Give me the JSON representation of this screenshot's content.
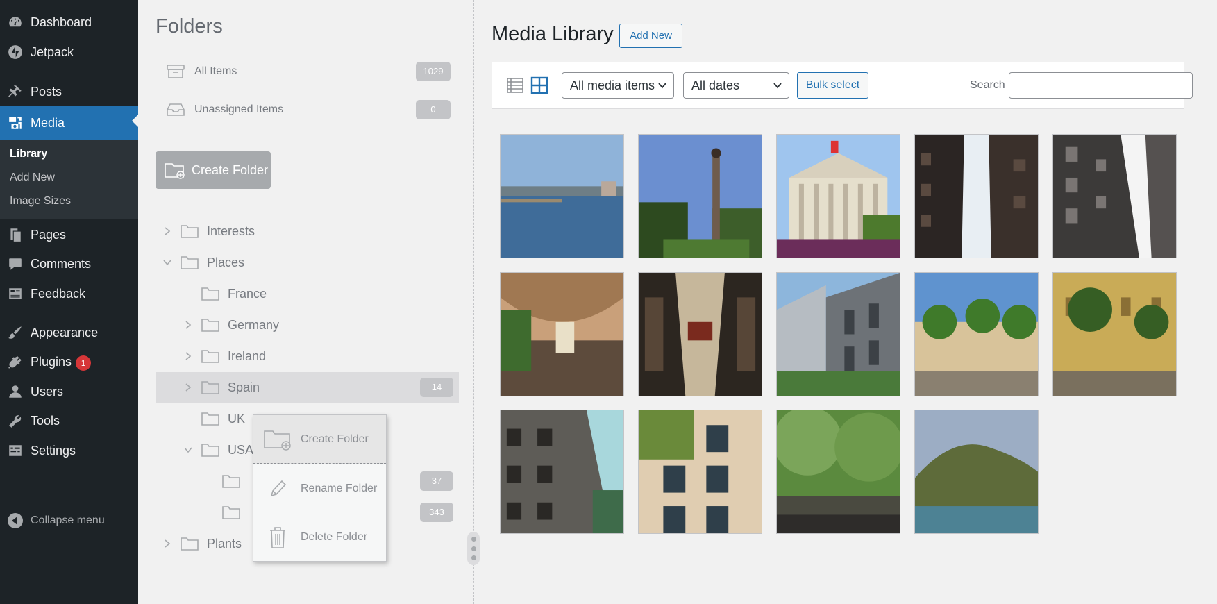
{
  "admin_menu": {
    "items": [
      {
        "label": "Dashboard",
        "icon": "dashboard-icon"
      },
      {
        "label": "Jetpack",
        "icon": "jetpack-icon"
      },
      {
        "label": "Posts",
        "icon": "pushpin-icon"
      },
      {
        "label": "Media",
        "icon": "media-icon"
      },
      {
        "label": "Pages",
        "icon": "pages-icon"
      },
      {
        "label": "Comments",
        "icon": "comment-icon"
      },
      {
        "label": "Feedback",
        "icon": "feedback-icon"
      },
      {
        "label": "Appearance",
        "icon": "paintbrush-icon"
      },
      {
        "label": "Plugins",
        "icon": "plugin-icon",
        "badge": "1"
      },
      {
        "label": "Users",
        "icon": "user-icon"
      },
      {
        "label": "Tools",
        "icon": "wrench-icon"
      },
      {
        "label": "Settings",
        "icon": "settings-icon"
      }
    ],
    "media_submenu": [
      "Library",
      "Add New",
      "Image Sizes"
    ],
    "collapse_label": "Collapse menu"
  },
  "folders": {
    "title": "Folders",
    "all_items": {
      "label": "All Items",
      "count": "1029"
    },
    "unassigned": {
      "label": "Unassigned Items",
      "count": "0"
    },
    "create_button": "Create Folder",
    "tree": [
      {
        "label": "Interests",
        "count": ""
      },
      {
        "label": "Places",
        "count": ""
      },
      {
        "label": "France",
        "count": ""
      },
      {
        "label": "Germany",
        "count": ""
      },
      {
        "label": "Ireland",
        "count": ""
      },
      {
        "label": "Spain",
        "count": "14"
      },
      {
        "label": "UK",
        "count": ""
      },
      {
        "label": "USA",
        "count": ""
      },
      {
        "label": "",
        "count": "37"
      },
      {
        "label": "",
        "count": "343"
      },
      {
        "label": "Plants",
        "count": ""
      }
    ],
    "context_menu": [
      "Create Folder",
      "Rename Folder",
      "Delete Folder"
    ]
  },
  "media": {
    "title": "Media Library",
    "add_new": "Add New",
    "filter_type": "All media items",
    "filter_date": "All dates",
    "bulk_select": "Bulk select",
    "search_label": "Search",
    "search_value": ""
  },
  "colors": {
    "sidebar_bg": "#1d2327",
    "accent": "#2271b1",
    "badge": "#d63638",
    "page_bg": "#f1f1f1"
  }
}
